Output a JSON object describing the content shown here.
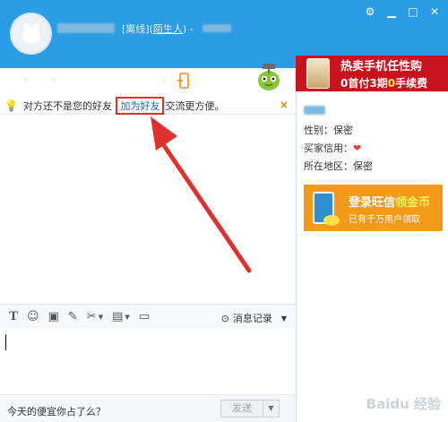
{
  "header": {
    "status_text": "[离线](",
    "stranger_label": "陌生人",
    "status_suffix": ") -",
    "window_controls": [
      "settings",
      "minimize",
      "maximize",
      "close"
    ]
  },
  "toolbar": {
    "items": [
      {
        "icon": "file-transfer-icon",
        "has_dropdown": true
      },
      {
        "icon": "microphone-icon",
        "has_dropdown": true
      },
      {
        "icon": "video-icon",
        "has_dropdown": false
      },
      {
        "icon": "add-contact-icon",
        "has_dropdown": false
      },
      {
        "icon": "screen-share-icon",
        "has_dropdown": false
      },
      {
        "icon": "robot-icon",
        "has_dropdown": true
      },
      {
        "icon": "mobile-icon",
        "has_dropdown": false
      }
    ]
  },
  "ad_top": {
    "line1": "热卖手机任性购",
    "line2_prefix": "0首付3期",
    "line2_highlight": "0",
    "line2_suffix": "手续费"
  },
  "notice": {
    "text_before": "对方还不是您的好友",
    "link": "加为好友",
    "text_after": "交流更方便。",
    "close": "×"
  },
  "input_toolbar": {
    "history_label": "消息记录"
  },
  "bottom": {
    "hint": "今天的便宜你占了么？",
    "send_label": "发送"
  },
  "right_panel": {
    "gender": "性别：保密",
    "credit": "买家信用：",
    "region": "所在地区：保密",
    "ad_line1_prefix": "登录旺信",
    "ad_line1_highlight": "领金币",
    "ad_line2": "已有千万用户领取"
  },
  "watermark": "Baidu 经验",
  "colors": {
    "header_bg": "#2b9de6",
    "ad_red": "#c8131f",
    "ad_orange": "#f39a1b",
    "link_blue": "#1a66c8",
    "annotation_red": "#e0312f"
  }
}
